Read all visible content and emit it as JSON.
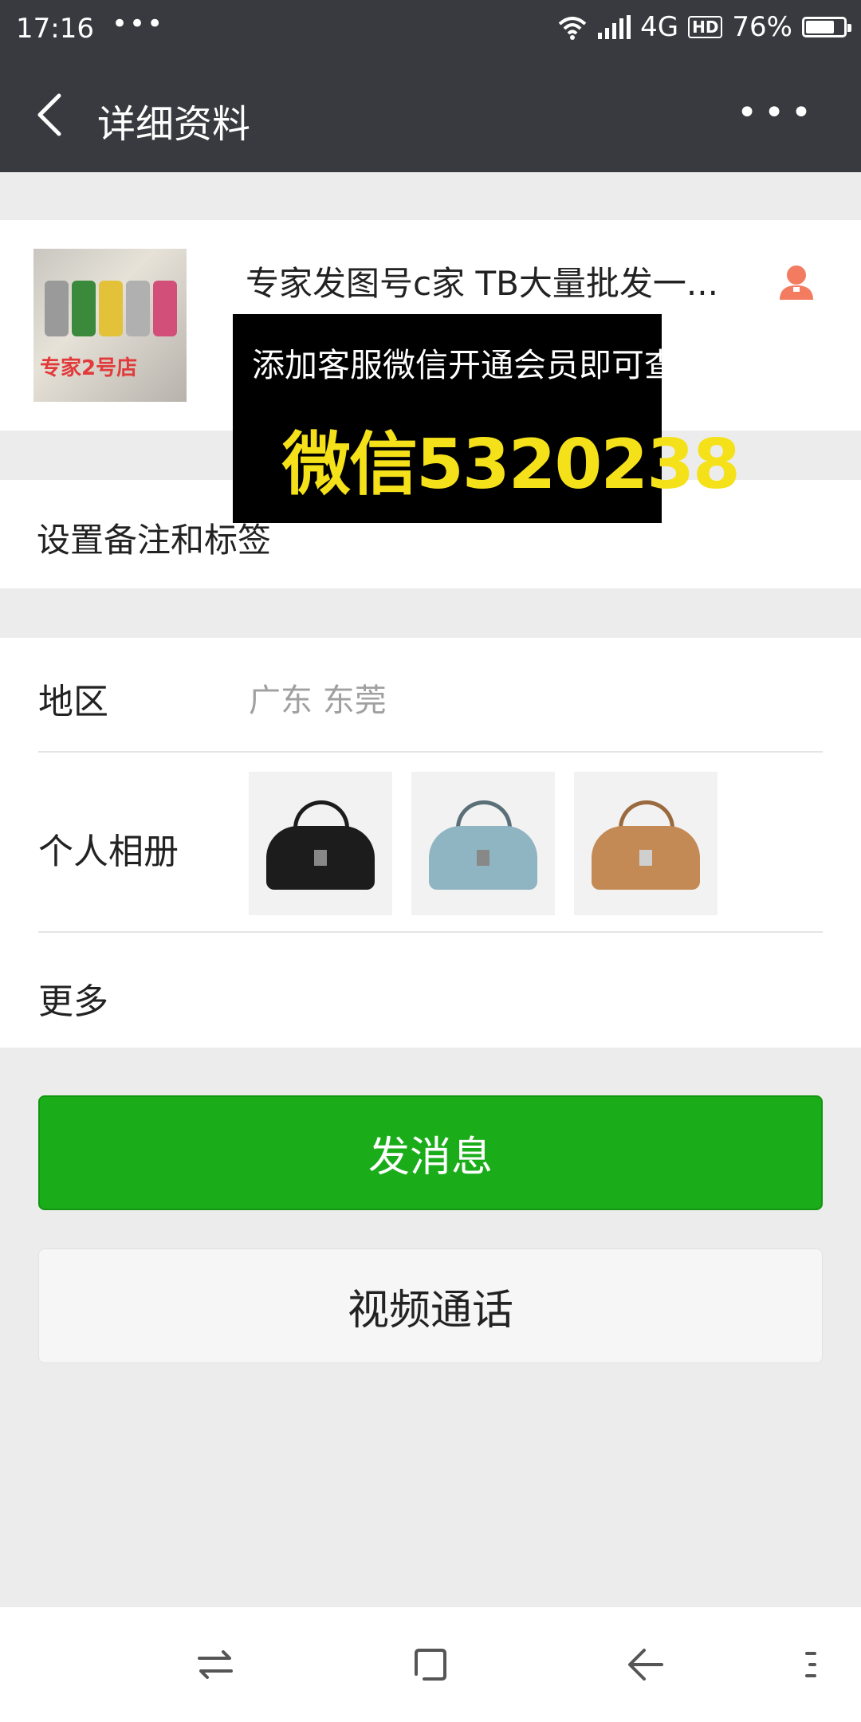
{
  "status_bar": {
    "time": "17:16",
    "dots": "•••",
    "network": "4G",
    "hd": "HD",
    "battery": "76%",
    "battery_level": 0.76
  },
  "nav": {
    "title": "详细资料",
    "back_icon": "chevron-left-icon",
    "more_icon": "more-dots-icon",
    "more_glyph": "•••"
  },
  "profile": {
    "name": "专家发图号c家 TB大量批发一...",
    "avatar_text": "专家2号店",
    "gender_icon": "female-user-icon",
    "gender_color": "#f37b5f"
  },
  "overlay": {
    "line1": "添加客服微信开通会员即可查看",
    "line2": "微信5320238",
    "text_color": "#f5e11a"
  },
  "remark": {
    "label": "设置备注和标签"
  },
  "info": {
    "region_label": "地区",
    "region_value": "广东  东莞",
    "album_label": "个人相册",
    "album_items": [
      {
        "color": "#1c1c1c"
      },
      {
        "color": "#8fb4c2"
      },
      {
        "color": "#c48a55"
      }
    ],
    "more_label": "更多"
  },
  "buttons": {
    "send": "发消息",
    "video": "视频通话",
    "accent": "#1aad19"
  },
  "system_nav": {
    "items": [
      "switch-icon",
      "home-square-icon",
      "back-arrow-icon",
      "menu-icon"
    ]
  }
}
